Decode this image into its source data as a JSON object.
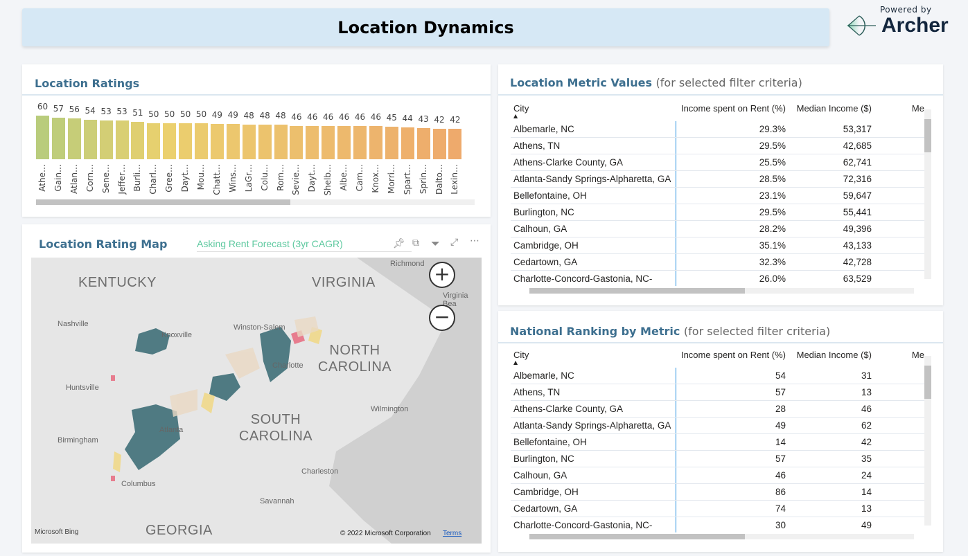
{
  "header": {
    "title": "Location Dynamics"
  },
  "logo": {
    "powered_by": "Powered by",
    "brand": "Archer"
  },
  "ratings": {
    "title": "Location Ratings",
    "chart_data": {
      "type": "bar",
      "categories": [
        "Athe…",
        "Gain…",
        "Atlan…",
        "Corn…",
        "Sene…",
        "Jeffer…",
        "Burli…",
        "Charl…",
        "Gree…",
        "Dayt…",
        "Mou…",
        "Chatt…",
        "Wins…",
        "LaGr…",
        "Colu…",
        "Rom…",
        "Sevie…",
        "Dayt…",
        "Shelb…",
        "Albe…",
        "Cam…",
        "Knox…",
        "Morri…",
        "Spart…",
        "Sprin…",
        "Dalto…",
        "Lexin…"
      ],
      "values": [
        60,
        57,
        56,
        54,
        53,
        53,
        51,
        50,
        50,
        50,
        50,
        49,
        49,
        48,
        48,
        48,
        46,
        46,
        46,
        46,
        46,
        46,
        45,
        44,
        43,
        42,
        42
      ],
      "colors": {
        "high": "#b9cc7c",
        "mid": "#ebd06e",
        "low": "#eeaa6c"
      },
      "scroll_fraction": 0.58
    }
  },
  "map": {
    "title": "Location Rating Map",
    "legend_title": "Asking Rent Forecast (3yr CAGR)",
    "states": [
      "KENTUCKY",
      "VIRGINIA",
      "NORTH CAROLINA",
      "SOUTH CAROLINA",
      "GEORGIA"
    ],
    "cities": [
      "Richmond",
      "Virginia Bea",
      "Nashville",
      "Knoxville",
      "Winston-Salem",
      "Charlotte",
      "Huntsville",
      "Atlanta",
      "Wilmington",
      "Birmingham",
      "Columbus",
      "Charleston",
      "Savannah"
    ],
    "attribution": "© 2022 Microsoft Corporation",
    "terms": "Terms",
    "bing": "Microsoft Bing",
    "zoom_in": "+",
    "zoom_out": "−",
    "colors": {
      "teal": "#3f6f78",
      "yellow": "#efd88a",
      "pink": "#e77c8e",
      "beige": "#ead9c4"
    }
  },
  "metric_table": {
    "title": "Location Metric Values",
    "subtitle": "(for selected filter criteria)",
    "columns": [
      "City",
      "Income spent on Rent (%)",
      "Median Income ($)",
      "Median In"
    ],
    "rows": [
      [
        "Albemarle, NC",
        "29.3%",
        "53,317"
      ],
      [
        "Athens, TN",
        "29.5%",
        "42,685"
      ],
      [
        "Athens-Clarke County, GA",
        "25.5%",
        "62,741"
      ],
      [
        "Atlanta-Sandy Springs-Alpharetta, GA",
        "28.5%",
        "72,316"
      ],
      [
        "Bellefontaine, OH",
        "23.1%",
        "59,647"
      ],
      [
        "Burlington, NC",
        "29.5%",
        "55,441"
      ],
      [
        "Calhoun, GA",
        "28.2%",
        "49,396"
      ],
      [
        "Cambridge, OH",
        "35.1%",
        "43,133"
      ],
      [
        "Cedartown, GA",
        "32.3%",
        "42,728"
      ],
      [
        "Charlotte-Concord-Gastonia, NC-",
        "26.0%",
        "63,529"
      ]
    ]
  },
  "ranking_table": {
    "title": "National Ranking by Metric",
    "subtitle": "(for selected filter criteria)",
    "columns": [
      "City",
      "Income spent on Rent (%)",
      "Median Income ($)",
      "Median In"
    ],
    "rows": [
      [
        "Albemarle, NC",
        "54",
        "31"
      ],
      [
        "Athens, TN",
        "57",
        "13"
      ],
      [
        "Athens-Clarke County, GA",
        "28",
        "46"
      ],
      [
        "Atlanta-Sandy Springs-Alpharetta, GA",
        "49",
        "62"
      ],
      [
        "Bellefontaine, OH",
        "14",
        "42"
      ],
      [
        "Burlington, NC",
        "57",
        "35"
      ],
      [
        "Calhoun, GA",
        "46",
        "24"
      ],
      [
        "Cambridge, OH",
        "86",
        "14"
      ],
      [
        "Cedartown, GA",
        "74",
        "13"
      ],
      [
        "Charlotte-Concord-Gastonia, NC-",
        "30",
        "49"
      ]
    ]
  }
}
